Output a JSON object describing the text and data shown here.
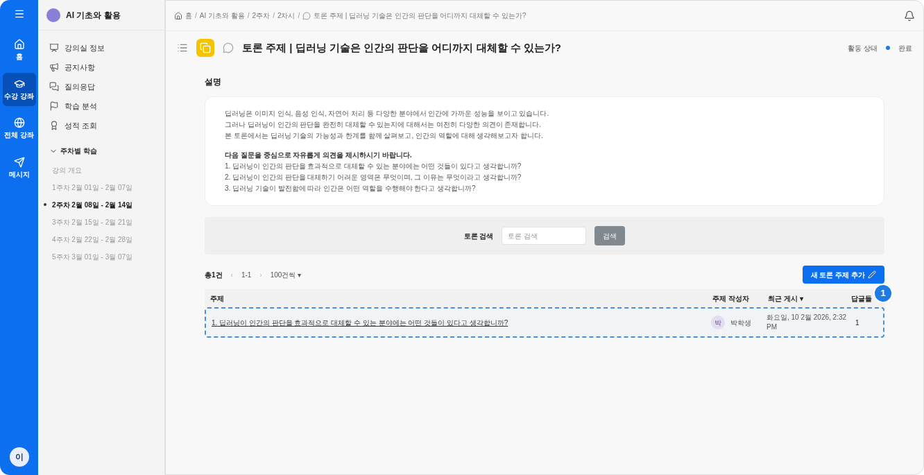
{
  "rail": {
    "items": [
      {
        "label": "홈",
        "selected": false
      },
      {
        "label": "수강 강좌",
        "selected": true
      },
      {
        "label": "전체 강좌",
        "selected": false
      },
      {
        "label": "메시지",
        "selected": false
      }
    ],
    "avatar": "이"
  },
  "sidebar": {
    "course": "AI 기초와 활용",
    "menu": [
      {
        "label": "강의실 정보"
      },
      {
        "label": "공지사항"
      },
      {
        "label": "질의응답"
      },
      {
        "label": "학습 분석"
      },
      {
        "label": "성적 조회"
      }
    ],
    "section": {
      "label": "주차별 학습",
      "expanded": true,
      "items": [
        {
          "label": "강의 개요",
          "selected": false
        },
        {
          "label": "1주차 2월 01일 - 2월 07일",
          "selected": false
        },
        {
          "label": "2주차 2월 08일 - 2월 14일",
          "selected": true
        },
        {
          "label": "3주차 2월 15일 - 2월 21일",
          "selected": false
        },
        {
          "label": "4주차 2월 22일 - 2월 28일",
          "selected": false
        },
        {
          "label": "5주차 3월 01일 - 3월 07일",
          "selected": false
        }
      ]
    }
  },
  "breadcrumb_separator": "/",
  "breadcrumb": [
    "홈",
    "AI 기초와 활용",
    "2주차",
    "2차시",
    "토론 주제 | 딥러닝 기술은 인간의 판단을 어디까지 대체할 수 있는가?"
  ],
  "title": "토론 주제 | 딥러닝 기술은 인간의 판단을 어디까지 대체할 수 있는가?",
  "status": {
    "label": "활동 상태",
    "value": "완료",
    "color": "#1e7be6"
  },
  "description": {
    "heading": "설명",
    "paragraph": [
      "딥러닝은 이미지 인식, 음성 인식, 자연어 처리 등 다양한 분야에서 인간에 가까운 성능을 보이고 있습니다.",
      "그러나 딥러닝이 인간의 판단을 완전히 대체할 수 있는지에 대해서는 여전히 다양한 의견이 존재합니다.",
      "본 토론에서는 딥러닝 기술의 가능성과 한계를 함께 살펴보고, 인간의 역할에 대해 생각해보고자 합니다."
    ],
    "prompt": "다음 질문을 중심으로 자유롭게 의견을 제시하시기 바랍니다.",
    "questions": [
      "1. 딥러닝이 인간의 판단을 효과적으로 대체할 수 있는 분야에는 어떤 것들이 있다고 생각합니까?",
      "2. 딥러닝이 인간의 판단을 대체하기 어려운 영역은 무엇이며, 그 이유는 무엇이라고 생각합니까?",
      "3. 딥러닝 기술이 발전함에 따라 인간은 어떤 역할을 수행해야 한다고 생각합니까?"
    ]
  },
  "search": {
    "label": "토론 검색",
    "placeholder": "토론 검색",
    "button": "검색"
  },
  "pager": {
    "total": "총1건",
    "prev": "‹",
    "range": "1-1",
    "next": "›",
    "per_page": "100건씩 ▾"
  },
  "add_button": "새 토론 주제 추가",
  "table": {
    "columns": [
      "주제",
      "주제 작성자",
      "최근 게시 ▾",
      "답글들"
    ],
    "rows": [
      {
        "topic": "1. 딥러닝이 인간의 판단을 효과적으로 대체할 수 있는 분야에는 어떤 것들이 있다고 생각합니까?",
        "author_initial": "박",
        "author": "박학생",
        "last_post": "화요일, 10 2월 2026, 2:32 PM",
        "replies": "1",
        "highlighted": true
      }
    ]
  },
  "callout": "1"
}
